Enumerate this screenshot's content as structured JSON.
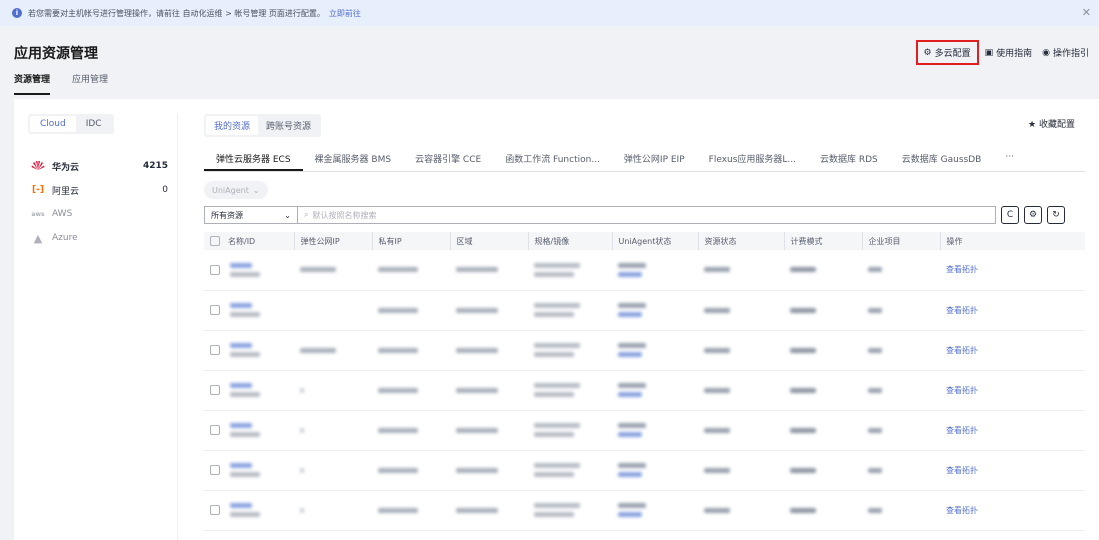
{
  "notice": {
    "text": "若您需要对主机帐号进行管理操作，请前往 自动化运维 > 帐号管理 页面进行配置。",
    "link": "立即前往"
  },
  "header": {
    "title": "应用资源管理",
    "tabs": [
      "资源管理",
      "应用管理"
    ],
    "actions": {
      "multi_cloud": "多云配置",
      "guide": "使用指南",
      "op_guide": "操作指引"
    }
  },
  "left": {
    "segments": [
      "Cloud",
      "IDC"
    ],
    "clouds": [
      {
        "name": "华为云",
        "count": "4215"
      },
      {
        "name": "阿里云",
        "count": "0"
      },
      {
        "name": "AWS",
        "count": ""
      },
      {
        "name": "Azure",
        "count": ""
      }
    ]
  },
  "right": {
    "segments": [
      "我的资源",
      "跨账号资源"
    ],
    "favorite": "收藏配置",
    "tabs": [
      "弹性云服务器 ECS",
      "裸金属服务器 BMS",
      "云容器引擎 CCE",
      "函数工作流 Function...",
      "弹性公网IP EIP",
      "Flexus应用服务器L...",
      "云数据库 RDS",
      "云数据库 GaussDB",
      "···"
    ],
    "agent_filter": "UniAgent",
    "select_value": "所有资源",
    "search_placeholder": "默认按照名称搜索",
    "columns": [
      "名称/ID",
      "弹性公网IP",
      "私有IP",
      "区域",
      "规格/镜像",
      "UniAgent状态",
      "资源状态",
      "计费模式",
      "企业项目",
      "操作"
    ],
    "row_action": "查看拓扑",
    "row_count": 7
  },
  "colors": {
    "accent": "#526ecc",
    "highlight": "#e02020",
    "huawei": "#e4002b",
    "aliyun": "#ff6a00"
  }
}
